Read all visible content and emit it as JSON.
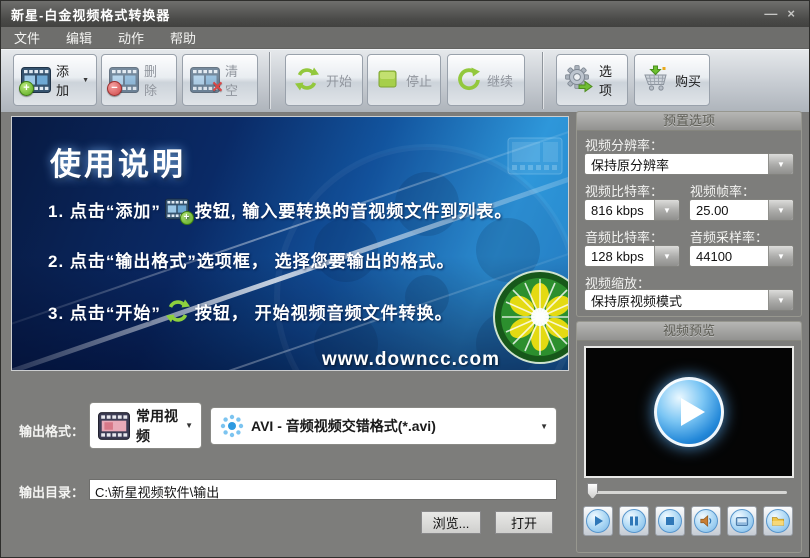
{
  "window": {
    "title": "新星-白金视频格式转换器",
    "minimize_glyph": "—",
    "close_glyph": "×"
  },
  "menu": {
    "items": [
      {
        "label": "文件"
      },
      {
        "label": "编辑"
      },
      {
        "label": "动作"
      },
      {
        "label": "帮助"
      }
    ]
  },
  "toolbar": {
    "add": "添加",
    "remove": "删除",
    "clear": "清空",
    "start": "开始",
    "stop": "停止",
    "resume": "继续",
    "options": "选项",
    "buy": "购买"
  },
  "instructions": {
    "title": "使用说明",
    "step1_pre": "1. 点击“添加”",
    "step1_post": "按钮, 输入要转换的音视频文件到列表。",
    "step2": "2. 点击“输出格式”选项框， 选择您要输出的格式。",
    "step3_pre": "3. 点击“开始”",
    "step3_post": "按钮， 开始视频音频文件转换。",
    "watermark": "www.downcc.com"
  },
  "presets": {
    "header": "预置选项",
    "resolution_label": "视频分辨率：",
    "resolution_value": "保持原分辨率",
    "video_bitrate_label": "视频比特率：",
    "video_bitrate_value": "816 kbps",
    "framerate_label": "视频帧率：",
    "framerate_value": "25.00",
    "audio_bitrate_label": "音频比特率：",
    "audio_bitrate_value": "128 kbps",
    "sample_rate_label": "音频采样率：",
    "sample_rate_value": "44100",
    "scale_label": "视频缩放：",
    "scale_value": "保持原视频模式"
  },
  "preview": {
    "header": "视频预览"
  },
  "output": {
    "format_label": "输出格式：",
    "category_value": "常用视频",
    "format_value": "AVI - 音频视频交错格式(*.avi)",
    "dir_label": "输出目录：",
    "dir_value": "C:\\新星视频软件\\输出",
    "browse_label": "浏览...",
    "open_label": "打开"
  },
  "glyphs": {
    "dropdown_arrow": "▼",
    "combo_caret": "▼",
    "add_caret": "▼"
  },
  "colors": {
    "accent_green": "#8cc63e",
    "panel_blue_dark": "#081a42",
    "panel_blue_light": "#2e97da",
    "play_button_blue": "#2287d8",
    "folder_yellow": "#f0c64a"
  }
}
